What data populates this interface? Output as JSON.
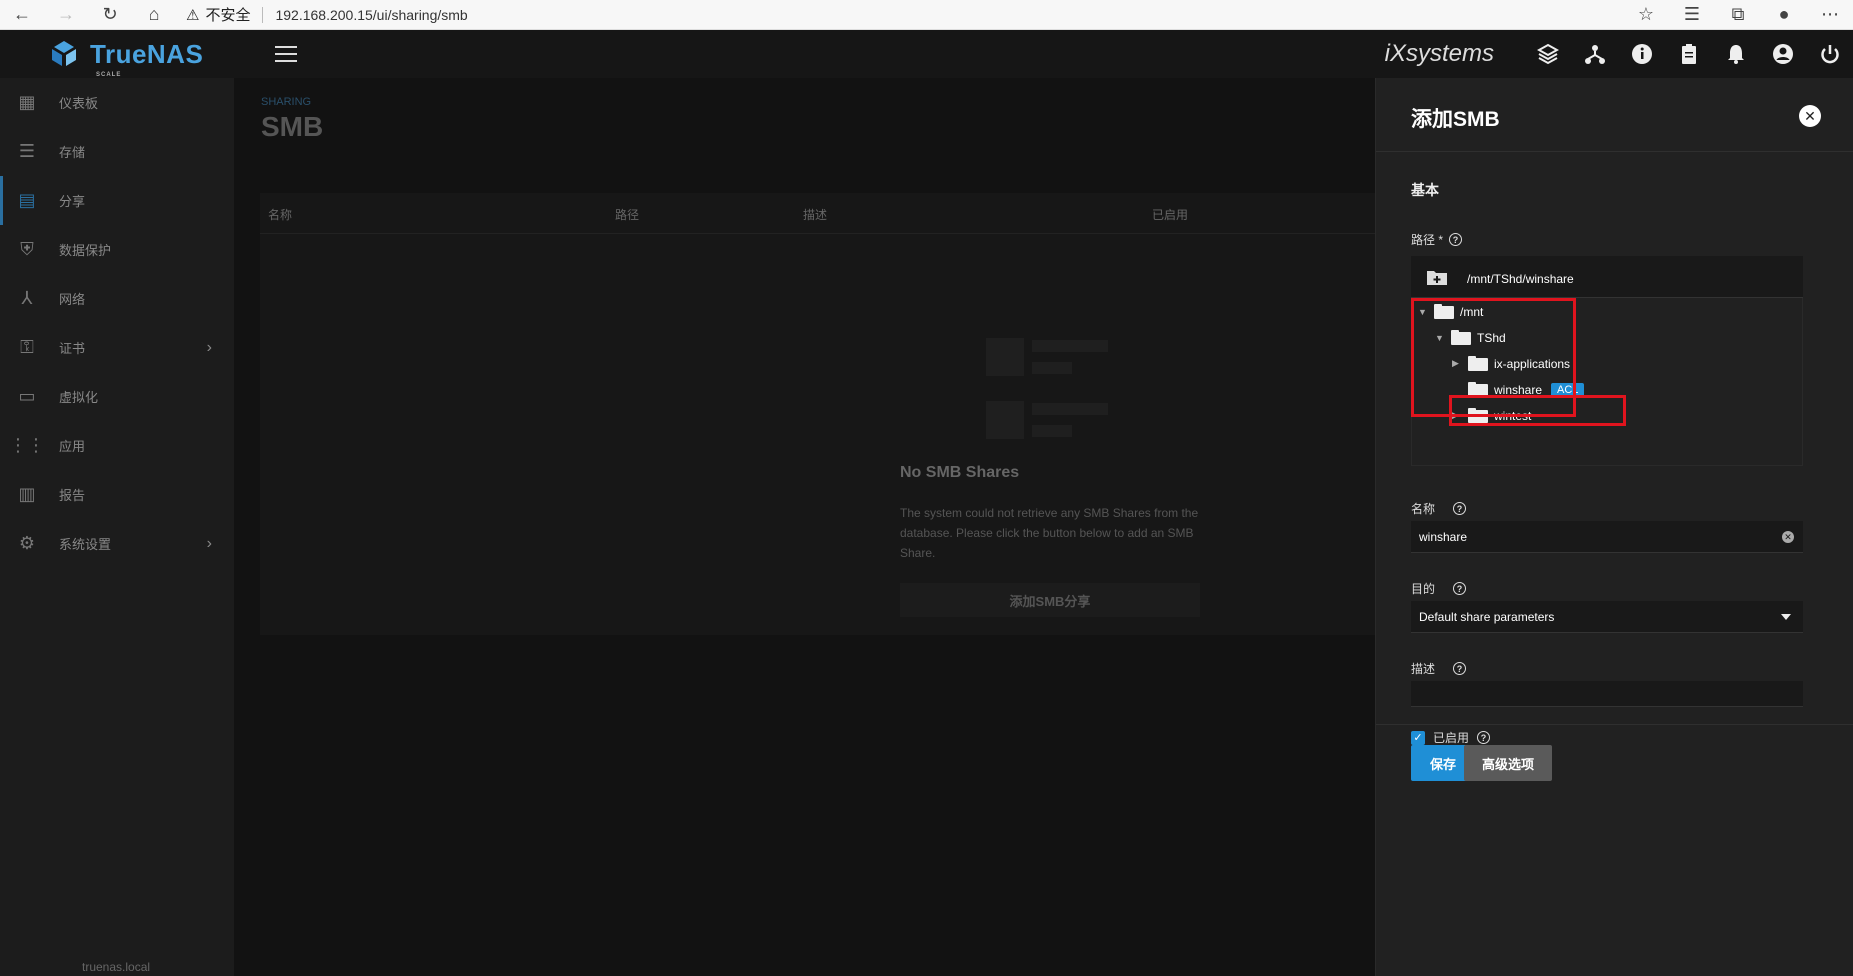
{
  "browser": {
    "security_label": "不安全",
    "url": "192.168.200.15/ui/sharing/smb"
  },
  "header": {
    "brand": "TrueNAS",
    "brand_sub": "SCALE",
    "vendor_logo": "iXsystems"
  },
  "sidebar": {
    "items": [
      {
        "label": "仪表板",
        "icon": "dashboard-icon"
      },
      {
        "label": "存储",
        "icon": "storage-icon"
      },
      {
        "label": "分享",
        "icon": "sharing-icon",
        "active": true
      },
      {
        "label": "数据保护",
        "icon": "shield-icon"
      },
      {
        "label": "网络",
        "icon": "network-icon"
      },
      {
        "label": "证书",
        "icon": "key-icon",
        "has_children": true
      },
      {
        "label": "虚拟化",
        "icon": "laptop-icon"
      },
      {
        "label": "应用",
        "icon": "apps-grid-icon"
      },
      {
        "label": "报告",
        "icon": "chart-icon"
      },
      {
        "label": "系统设置",
        "icon": "gear-icon",
        "has_children": true
      }
    ],
    "hostname": "truenas.local"
  },
  "main": {
    "breadcrumb": "SHARING",
    "title": "SMB",
    "columns": [
      "名称",
      "路径",
      "描述",
      "已启用"
    ],
    "empty_title": "No SMB Shares",
    "empty_desc": "The system could not retrieve any SMB Shares from the database. Please click the button below to add an SMB Share.",
    "empty_button": "添加SMB分享"
  },
  "panel": {
    "title": "添加SMB",
    "section": "基本",
    "path_label": "路径 *",
    "path_value": "/mnt/TShd/winshare",
    "tree": [
      {
        "label": "/mnt",
        "expanded": true
      },
      {
        "label": "TShd",
        "expanded": true
      },
      {
        "label": "ix-applications",
        "expanded": false
      },
      {
        "label": "winshare",
        "badge": "ACL"
      },
      {
        "label": "wintest",
        "expanded": false
      }
    ],
    "name_label": "名称",
    "name_value": "winshare",
    "purpose_label": "目的",
    "purpose_value": "Default share parameters",
    "desc_label": "描述",
    "desc_value": "",
    "enabled_label": "已启用",
    "enabled": true,
    "save_button": "保存",
    "advanced_button": "高级选项"
  },
  "colors": {
    "accent": "#1f8fd6",
    "highlight": "#e0141e"
  }
}
